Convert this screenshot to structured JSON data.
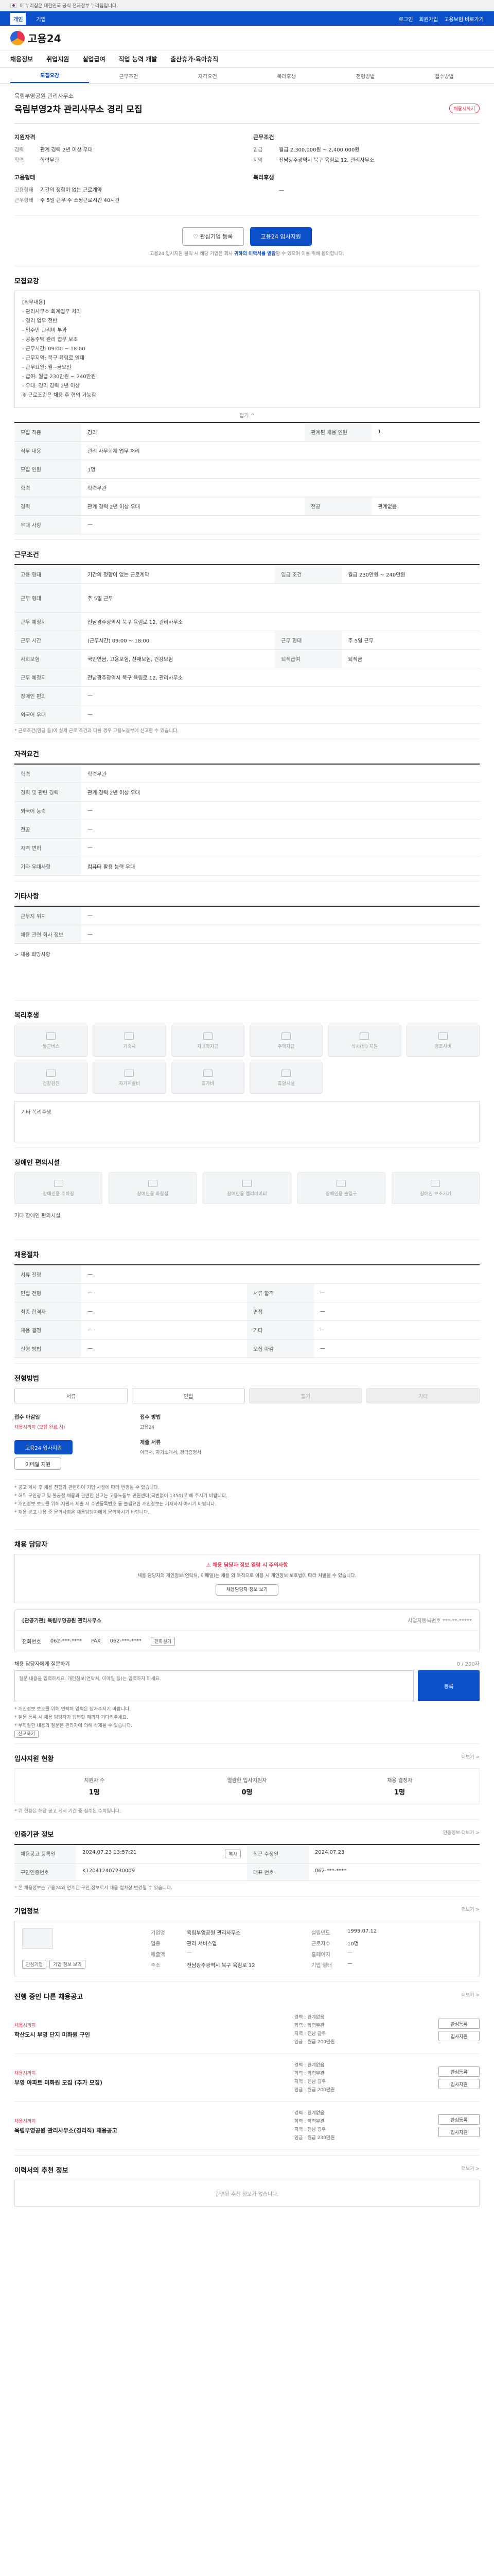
{
  "gov_banner": "이 누리집은 대한민국 공식 전자정부 누리집입니다.",
  "util": {
    "tabs": [
      "개인",
      "기업"
    ],
    "right": [
      "로그인",
      "회원가입",
      "고용보험 바로가기"
    ]
  },
  "brand": {
    "name": "고용24"
  },
  "gnb": [
    "채용정보",
    "취업지원",
    "실업급여",
    "직업 능력 개발",
    "출산휴가·육아휴직"
  ],
  "subtabs": [
    "모집요강",
    "근무조건",
    "자격요건",
    "복리후생",
    "전형방법",
    "접수방법"
  ],
  "job": {
    "company": "육림부영공원 관리사무소",
    "title": "육림부영2차 관리사무소 경리 모집",
    "badge": "채용시까지",
    "summary_left_title": "지원자격",
    "summary_left": [
      {
        "k": "경력",
        "v": "관계 경력 2년 이상 우대"
      },
      {
        "k": "학력",
        "v": "학력무관"
      }
    ],
    "summary_right_title": "근무조건",
    "summary_right": [
      {
        "k": "임금",
        "v": "월급 2,300,000원 ~ 2,400,000원"
      },
      {
        "k": "지역",
        "v": "전남광주광역시 북구 육림로 12, 관리사무소"
      }
    ],
    "summary_left2_title": "고용형태",
    "summary_left2": [
      {
        "k": "고용형태",
        "v": "기간의 정함이 없는 근로계약"
      },
      {
        "k": "근무형태",
        "v": "주 5일 근무 주 소정근로시간 40시간"
      }
    ],
    "summary_right2_title": "복리후생",
    "summary_right2": [
      {
        "k": "",
        "v": "—"
      }
    ]
  },
  "cta": {
    "interest": "관심기업 등록",
    "apply": "고용24 입사지원",
    "note_prefix": "고용24 입사지원 클릭 시 해당 기업은 회사 ",
    "note_link": "귀하의 이력서를 열람",
    "note_suffix": "할 수 있으며 이를 위해 동의합니다."
  },
  "recruit": {
    "heading": "모집요강",
    "desc": "[직무내용]\n- 관리사무소 회계업무 처리\n- 경리 업무 전반\n- 입주민 관리비 부과\n- 공동주택 관리 업무 보조\n- 근무시간: 09:00 ~ 18:00\n- 근무지역: 북구 육림로 일대\n- 근무요일: 월~금요일\n- 급여: 월급 230만원 ~ 240만원\n- 우대: 경리 경력 2년 이상\n※ 근로조건은 채용 후 협의 가능함",
    "fold": "접기 ^",
    "rows": [
      {
        "k": "모집 직종",
        "v": "경리",
        "k2": "관계된 채용 인원",
        "v2": "1"
      },
      {
        "k": "직무 내용",
        "v": "관리 사무회계 업무 처리",
        "k2": "",
        "v2": ""
      },
      {
        "k": "모집 인원",
        "v": "1명",
        "k2": "",
        "v2": ""
      },
      {
        "k": "학력",
        "v": "학력무관",
        "k2": "",
        "v2": ""
      },
      {
        "k": "경력",
        "v": "관계 경력 2년 이상 우대",
        "k2": "전공",
        "v2": "관계없음"
      },
      {
        "k": "우대 사항",
        "v": "—",
        "k2": "",
        "v2": ""
      }
    ]
  },
  "work": {
    "heading": "근무조건",
    "rows": [
      {
        "k": "고용 형태",
        "v": "기간의 정함이 없는 근로계약",
        "k2": "임금 조건",
        "v2": "월급 230만원 ~ 240만원"
      },
      {
        "k": "근무 형태",
        "v": "주 5일 근무",
        "k2": "",
        "v2": ""
      },
      {
        "k": "근무 예정지",
        "v": "전남광주광역시 북구 육림로 12, 관리사무소",
        "k2": "",
        "v2": ""
      },
      {
        "k": "근무 시간",
        "v": "(근무시간) 09:00 ~ 18:00",
        "k2": "근무 형태",
        "v2": "주 5일 근무"
      },
      {
        "k": "사회보험",
        "v": "국민연금, 고용보험, 산재보험, 건강보험",
        "k2": "퇴직급여",
        "v2": "퇴직금"
      },
      {
        "k": "근무 예정지",
        "v": "전남광주광역시 북구 육림로 12, 관리사무소",
        "k2": "",
        "v2": ""
      },
      {
        "k": "장애인 편의",
        "v": "—",
        "k2": "",
        "v2": ""
      },
      {
        "k": "외국어 우대",
        "v": "—",
        "k2": "",
        "v2": ""
      }
    ],
    "footnote": "* 근로조건(임금 등)이 실제 근로 조건과 다를 경우 고용노동부에 신고할 수 있습니다."
  },
  "qual": {
    "heading": "자격요건",
    "rows": [
      {
        "k": "학력",
        "v": "학력무관"
      },
      {
        "k": "경력 및 관련 경력",
        "v": "관계 경력 2년 이상 우대"
      },
      {
        "k": "외국어 능력",
        "v": "—"
      },
      {
        "k": "전공",
        "v": "—"
      },
      {
        "k": "자격 면허",
        "v": "—"
      },
      {
        "k": "기타 우대사항",
        "v": "컴퓨터 활용 능력 우대"
      }
    ]
  },
  "other": {
    "heading": "기타사항",
    "rows": [
      {
        "k": "근무지 위치",
        "v": "—"
      },
      {
        "k": "채용 관련 회사 정보",
        "v": "—"
      }
    ],
    "extra": "> 채용 희망사항"
  },
  "benefit": {
    "heading": "복리후생",
    "items": [
      "통근버스",
      "기숙사",
      "자녀학자금",
      "주택자금",
      "식사(비) 지원",
      "경조사비",
      "건강검진",
      "자기계발비",
      "휴가비",
      "휴양시설"
    ],
    "etc_label": "기타 복리후생"
  },
  "support": {
    "heading": "장애인 편의시설",
    "items": [
      "장애인용 주차장",
      "장애인용 화장실",
      "장애인용 엘리베이터",
      "장애인용 출입구",
      "장애인 보조기기"
    ],
    "etc_label": "기타 장애인 편의시설"
  },
  "placement": {
    "heading": "채용절차",
    "rows": [
      {
        "k": "서류 전형",
        "v": "—",
        "k2": "",
        "v2": ""
      },
      {
        "k": "면접 전형",
        "v": "—",
        "k2": "서류 합격",
        "v2": "—"
      },
      {
        "k": "최종 합격자",
        "v": "—",
        "k2": "면접",
        "v2": "—"
      },
      {
        "k": "채용 결정",
        "v": "—",
        "k2": "기타",
        "v2": "—"
      },
      {
        "k": "전형 방법",
        "v": "—",
        "k2": "모집 마감",
        "v2": "—"
      }
    ]
  },
  "apply": {
    "heading": "전형방법",
    "tabs": [
      "서류",
      "면접",
      "필기",
      "기타"
    ],
    "deadline_title": "접수 마감일",
    "deadline": "채용시까지 (모집 완료 시)",
    "method_title": "접수 방법",
    "method": "고용24",
    "documents_title": "제출 서류",
    "documents": "이력서, 자기소개서, 경력증명서",
    "apply_btn": "고용24 입사지원",
    "email_btn": "이메일 지원",
    "bullets": [
      "* 공고 게시 후 채용 진행과 관련하여 기업 사정에 따라 변경될 수 있습니다.",
      "* 허위 구인광고 및 불공정 채용과 관련한 신고는 고용노동부 민원센터(국번없이 1350)로 해 주시기 바랍니다.",
      "* 개인정보 보호를 위해 지원서 제출 시 주민등록번호 등 불필요한 개인정보는 기재하지 마시기 바랍니다.",
      "* 채용 공고 내용 중 문의사항은 채용담당자에게 문의하시기 바랍니다."
    ]
  },
  "contact": {
    "heading": "채용 담당자",
    "warn_title": "채용 담당자 정보 열람 시 주의사항",
    "warn_text": "채용 담당자의 개인정보(연락처, 이메일)는 채용 외 목적으로 이용 시 개인정보 보호법에 따라 처벌될 수 있습니다.",
    "warn_btn": "채용담당자 정보 보기",
    "org": "[관공기관] 육림부영공원 관리사무소",
    "org_meta": "사업자등록번호 ***-**-*****",
    "tel_label": "전화번호",
    "tel": "062-***-****",
    "fax_label": "FAX",
    "fax": "062-***-****",
    "tel_btn": "전화걸기",
    "inquiry_title": "채용 담당자에게 질문하기",
    "inquiry_meta": "0 / 200자",
    "inquiry_placeholder": "질문 내용을 입력하세요. 개인정보(연락처, 이메일 등)는 입력하지 마세요.",
    "send_btn": "등록",
    "notes": [
      "* 개인정보 보호를 위해 연락처 입력은 삼가주시기 바랍니다.",
      "* 질문 등록 시 채용 담당자가 답변할 때까지 기다려주세요.",
      "* 부적절한 내용의 질문은 관리자에 의해 삭제될 수 있습니다."
    ],
    "report_btn": "신고하기"
  },
  "stats": {
    "heading": "입사지원 현황",
    "more": "더보기 >",
    "items": [
      {
        "label": "지원자 수",
        "num": "1명"
      },
      {
        "label": "열람한 입사지원자",
        "num": "0명"
      },
      {
        "label": "채용 결정자",
        "num": "1명"
      }
    ],
    "footnote": "* 위 현황은 해당 공고 게시 기간 중 집계된 수치입니다."
  },
  "loan": {
    "heading": "인증기관 정보",
    "more": "인증정보 더보기 >",
    "rows": [
      {
        "k": "채용공고 등록일",
        "v": "2024.07.23 13:57:21",
        "k2": "최근 수정일",
        "v2": "2024.07.23"
      },
      {
        "k": "구인인증번호",
        "v": "K120412407230009",
        "k2": "대표 번호",
        "v2": "062-***-****"
      }
    ],
    "copy": "복사",
    "footnote": "* 본 채용정보는 고용24와 연계된 구인 정보로서 채용 절차상 변경될 수 있습니다."
  },
  "company": {
    "heading": "기업정보",
    "more": "더보기 >",
    "tag1": "관심기업",
    "tag2": "기업 정보 보기",
    "kvs": [
      {
        "k": "기업명",
        "v": "육림부영공원 관리사무소"
      },
      {
        "k": "설립년도",
        "v": "1999.07.12"
      },
      {
        "k": "업종",
        "v": "관리 서비스업"
      },
      {
        "k": "근로자수",
        "v": "10명"
      },
      {
        "k": "매출액",
        "v": "—"
      },
      {
        "k": "홈페이지",
        "v": "—"
      },
      {
        "k": "주소",
        "v": "전남광주광역시 북구 육림로 12"
      },
      {
        "k": "기업 형태",
        "v": "—"
      }
    ]
  },
  "related": {
    "heading": "진행 중인 다른 채용공고",
    "more": "더보기 >",
    "items": [
      {
        "co": "채용시까지",
        "title": "학산도시 부영 단지 미화원 구인",
        "meta": [
          "경력 : 관계없음",
          "학력 : 학력무관",
          "지역 : 전남 광주",
          "임금 : 월급 200만원"
        ],
        "b1": "관심등록",
        "b2": "입사지원"
      },
      {
        "co": "채용시까지",
        "title": "부영 아파트 미화원 모집 (추가 모집)",
        "meta": [
          "경력 : 관계없음",
          "학력 : 학력무관",
          "지역 : 전남 광주",
          "임금 : 월급 200만원"
        ],
        "b1": "관심등록",
        "b2": "입사지원"
      },
      {
        "co": "채용시까지",
        "title": "육림부영공원 관리사무소(경리직) 채용공고",
        "meta": [
          "경력 : 관계없음",
          "학력 : 학력무관",
          "지역 : 전남 광주",
          "임금 : 월급 230만원"
        ],
        "b1": "관심등록",
        "b2": "입사지원"
      }
    ]
  },
  "similar": {
    "heading": "이력서의 추천 정보",
    "more": "더보기 >",
    "empty": "관련된 추천 정보가 없습니다."
  }
}
